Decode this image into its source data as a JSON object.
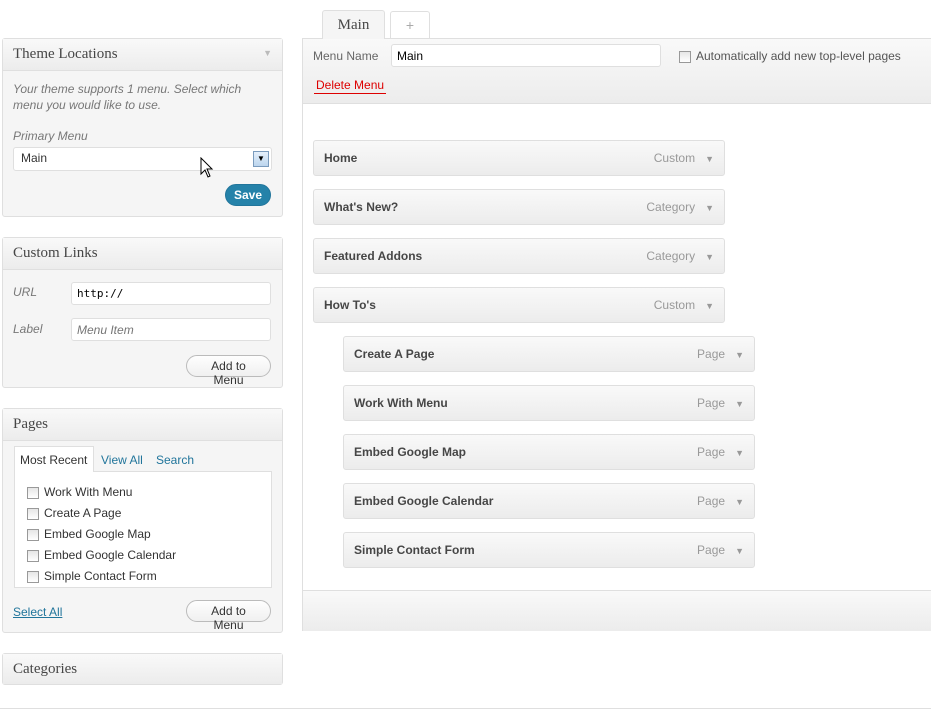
{
  "theme_locations": {
    "title": "Theme Locations",
    "description": "Your theme supports 1 menu. Select which menu you would like to use.",
    "primary_label": "Primary Menu",
    "primary_value": "Main",
    "save": "Save"
  },
  "custom_links": {
    "title": "Custom Links",
    "url_label": "URL",
    "url_value": "http://",
    "label_label": "Label",
    "label_placeholder": "Menu Item",
    "add": "Add to Menu"
  },
  "pages": {
    "title": "Pages",
    "tabs": [
      "Most Recent",
      "View All",
      "Search"
    ],
    "items": [
      "Work With Menu",
      "Create A Page",
      "Embed Google Map",
      "Embed Google Calendar",
      "Simple Contact Form"
    ],
    "select_all": "Select All",
    "add": "Add to Menu"
  },
  "categories": {
    "title": "Categories"
  },
  "menu": {
    "tabs": [
      "Main",
      "+"
    ],
    "name_label": "Menu Name",
    "name_value": "Main",
    "auto_add": "Automatically add new top-level pages",
    "delete": "Delete Menu",
    "items": [
      {
        "title": "Home",
        "type": "Custom",
        "depth": 0
      },
      {
        "title": "What's New?",
        "type": "Category",
        "depth": 0
      },
      {
        "title": "Featured Addons",
        "type": "Category",
        "depth": 0
      },
      {
        "title": "How To's",
        "type": "Custom",
        "depth": 0
      },
      {
        "title": "Create A Page",
        "type": "Page",
        "depth": 1
      },
      {
        "title": "Work With Menu",
        "type": "Page",
        "depth": 1
      },
      {
        "title": "Embed Google Map",
        "type": "Page",
        "depth": 1
      },
      {
        "title": "Embed Google Calendar",
        "type": "Page",
        "depth": 1
      },
      {
        "title": "Simple Contact Form",
        "type": "Page",
        "depth": 1
      }
    ]
  }
}
